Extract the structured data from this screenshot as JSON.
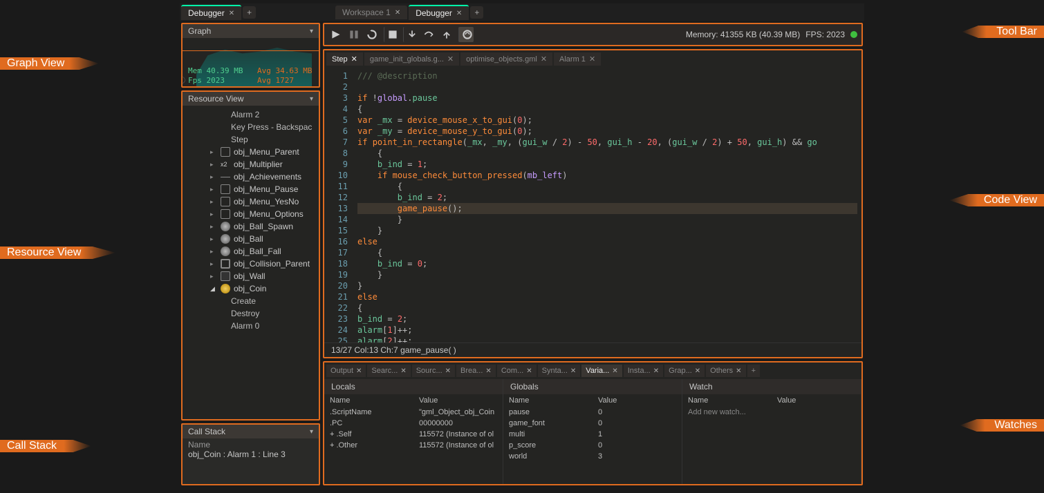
{
  "callouts": {
    "graph_view": "Graph View",
    "resource_view": "Resource View",
    "call_stack": "Call Stack",
    "tool_bar": "Tool Bar",
    "code_view": "Code View",
    "watches": "Watches"
  },
  "top_tabs_left": [
    {
      "label": "Debugger",
      "active": true
    }
  ],
  "top_tabs_right": [
    {
      "label": "Workspace 1",
      "active": false
    },
    {
      "label": "Debugger",
      "active": true
    }
  ],
  "graph": {
    "header": "Graph",
    "mem_label": "Mem",
    "mem_value": "40.39 MB",
    "mem_avg_label": "Avg",
    "mem_avg_value": "34.63 MB",
    "fps_label": "Fps",
    "fps_value": "2023",
    "fps_avg_label": "Avg",
    "fps_avg_value": "1727"
  },
  "resource_view": {
    "header": "Resource View",
    "pre_items": [
      "Alarm 2",
      "Key Press - Backspac",
      "Step"
    ],
    "items": [
      {
        "label": "obj_Menu_Parent",
        "icon": "box"
      },
      {
        "label": "obj_Multiplier",
        "icon": "x2"
      },
      {
        "label": "obj_Achievements",
        "icon": "line"
      },
      {
        "label": "obj_Menu_Pause",
        "icon": "box"
      },
      {
        "label": "obj_Menu_YesNo",
        "icon": "box"
      },
      {
        "label": "obj_Menu_Options",
        "icon": "box"
      },
      {
        "label": "obj_Ball_Spawn",
        "icon": "ball"
      },
      {
        "label": "obj_Ball",
        "icon": "ball"
      },
      {
        "label": "obj_Ball_Fall",
        "icon": "ball"
      },
      {
        "label": "obj_Collision_Parent",
        "icon": "bigbox"
      },
      {
        "label": "obj_Wall",
        "icon": "dark"
      },
      {
        "label": "obj_Coin",
        "icon": "coin",
        "expanded": true,
        "children": [
          "Create",
          "Destroy",
          "Alarm 0"
        ]
      }
    ]
  },
  "callstack": {
    "header": "Call Stack",
    "col_name": "Name",
    "entry": "obj_Coin : Alarm 1 : Line 3"
  },
  "toolbar": {
    "memory_label": "Memory:",
    "memory_value": "41355 KB (40.39 MB)",
    "fps_label": "FPS:",
    "fps_value": "2023"
  },
  "code_tabs": [
    {
      "label": "Step",
      "active": true
    },
    {
      "label": "game_init_globals.g...",
      "active": false
    },
    {
      "label": "optimise_objects.gml",
      "active": false
    },
    {
      "label": "Alarm 1",
      "active": false
    }
  ],
  "code": {
    "lines": 25,
    "hl_line": 13,
    "status": "13/27 Col:13 Ch:7    game_pause( )"
  },
  "bottom_tabs": [
    {
      "label": "Output"
    },
    {
      "label": "Searc..."
    },
    {
      "label": "Sourc..."
    },
    {
      "label": "Brea..."
    },
    {
      "label": "Com..."
    },
    {
      "label": "Synta..."
    },
    {
      "label": "Varia...",
      "active": true
    },
    {
      "label": "Insta..."
    },
    {
      "label": "Grap..."
    },
    {
      "label": "Others"
    }
  ],
  "watch": {
    "locals": {
      "header": "Locals",
      "col_name": "Name",
      "col_value": "Value",
      "rows": [
        {
          "name": ".ScriptName",
          "value": "\"gml_Object_obj_Coin"
        },
        {
          "name": ".PC",
          "value": "00000000"
        },
        {
          "name": ".Self",
          "value": "115572 (Instance of ol",
          "expand": true
        },
        {
          "name": ".Other",
          "value": "115572 (Instance of ol",
          "expand": true
        }
      ]
    },
    "globals": {
      "header": "Globals",
      "col_name": "Name",
      "col_value": "Value",
      "rows": [
        {
          "name": "pause",
          "value": "0"
        },
        {
          "name": "game_font",
          "value": "0"
        },
        {
          "name": "multi",
          "value": "1"
        },
        {
          "name": "p_score",
          "value": "0"
        },
        {
          "name": "world",
          "value": "3"
        }
      ]
    },
    "watchpane": {
      "header": "Watch",
      "col_name": "Name",
      "col_value": "Value",
      "placeholder": "Add new watch..."
    }
  }
}
